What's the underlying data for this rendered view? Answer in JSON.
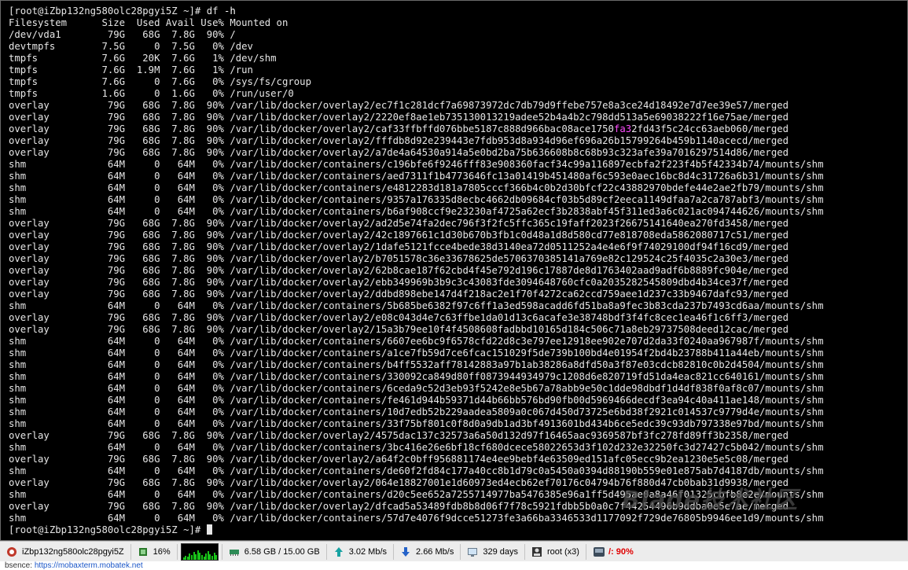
{
  "terminal": {
    "prompt": "[root@iZbp132ng580olc28pgyi5Z ~]# ",
    "command": "df",
    "command_arg": "-h",
    "header": "Filesystem      Size  Used Avail Use% Mounted on",
    "rows": [
      "/dev/vda1        79G   68G  7.8G  90% /",
      "devtmpfs        7.5G     0  7.5G   0% /dev",
      "tmpfs           7.6G   20K  7.6G   1% /dev/shm",
      "tmpfs           7.6G  1.9M  7.6G   1% /run",
      "tmpfs           7.6G     0  7.6G   0% /sys/fs/cgroup",
      "tmpfs           1.6G     0  1.6G   0% /run/user/0",
      "overlay          79G   68G  7.8G  90% /var/lib/docker/overlay2/ec7f1c281dcf7a69873972dc7db79d9ffebe757e8a3ce24d18492e7d7ee39e57/merged",
      "overlay          79G   68G  7.8G  90% /var/lib/docker/overlay2/2220ef8ae1eb735130013219adee52b4a4b2c798dd513a5e69038222f16e75ae/merged",
      "overlay          79G   68G  7.8G  90% /var/lib/docker/overlay2/caf33ffbffd076bbe5187c888d966bac08ace1750fa32fd43f5c24cc63aeb060/merged",
      "overlay          79G   68G  7.8G  90% /var/lib/docker/overlay2/fffdb8d92e239443e7fdb953d8a934d96ef696a26b15799264b459b1140acecd/merged",
      "overlay          79G   68G  7.8G  90% /var/lib/docker/overlay2/a7de4a64530a914a5e0bd2ba75b636608b8c68b93c323afe39a7016297514d86/merged",
      "shm              64M     0   64M   0% /var/lib/docker/containers/c196bfe6f9246fff83e908360facf34c99a116897ecbfa2f223f4b5f42334b74/mounts/shm",
      "shm              64M     0   64M   0% /var/lib/docker/containers/aed7311f1b4773646fc13a01419b451480af6c593e0aec16bc8d4c31726a6b31/mounts/shm",
      "shm              64M     0   64M   0% /var/lib/docker/containers/e4812283d181a7805cccf366b4c0b2d30bfcf22c43882970bdefe44e2ae2fb79/mounts/shm",
      "shm              64M     0   64M   0% /var/lib/docker/containers/9357a176335d8ecbc4662db09684cf03b5d89cf2eeca1149dfaa7a2ca787abf3/mounts/shm",
      "shm              64M     0   64M   0% /var/lib/docker/containers/b6af908ccf9e23230af4725a62ecf3b2838abf45f311ed3a6c021ac094744626/mounts/shm",
      "overlay          79G   68G  7.8G  90% /var/lib/docker/overlay2/ad2d5e74fa2dec796f3f2fc5ffc365c19faff2023f26675141640ea270fd3458/merged",
      "overlay          79G   68G  7.8G  90% /var/lib/docker/overlay2/42c1897661c1d30b670b3fb1c0d48a1d8d580cd77e818708eda5862080717c51/merged",
      "overlay          79G   68G  7.8G  90% /var/lib/docker/overlay2/1dafe5121fcce4bede38d3140ea72d0511252a4e4e6f9f74029100df94f16cd9/merged",
      "overlay          79G   68G  7.8G  90% /var/lib/docker/overlay2/b7051578c36e33678625de5706370385141a769e82c129524c25f4035c2a30e3/merged",
      "overlay          79G   68G  7.8G  90% /var/lib/docker/overlay2/62b8cae187f62cbd4f45e792d196c17887de8d1763402aad9adf6b8889fc904e/merged",
      "overlay          79G   68G  7.8G  90% /var/lib/docker/overlay2/ebb349969b3b9c3c43083fde3094648760cfc0a2035282545809dbd4b34ce37f/merged",
      "overlay          79G   68G  7.8G  90% /var/lib/docker/overlay2/ddbd898ebe147d4f218ac2e1f70f4272ca62ccd759aee1d237c33b9467dafc93/merged",
      "shm              64M     0   64M   0% /var/lib/docker/containers/5b685be6382f97c6ff1a3ed598acadd6fd51ba8a9fec3b83cda237b7493cd6aa/mounts/shm",
      "overlay          79G   68G  7.8G  90% /var/lib/docker/overlay2/e08c043d4e7c63ffbe1da01d13c6acafe3e38748bdf3f4fc8cec1ea46f1c6ff3/merged",
      "overlay          79G   68G  7.8G  90% /var/lib/docker/overlay2/15a3b79ee10f4f4508608fadbbd10165d184c506c71a8eb29737508deed12cac/merged",
      "shm              64M     0   64M   0% /var/lib/docker/containers/6607ee6bc9f6578cfd22d8c3e797ee12918ee902e707d2da33f0240aa967987f/mounts/shm",
      "shm              64M     0   64M   0% /var/lib/docker/containers/a1ce7fb59d7ce6fcac151029f5de739b100bd4e01954f2bd4b23788b411a44eb/mounts/shm",
      "shm              64M     0   64M   0% /var/lib/docker/containers/b4ff5532aff78142883a97b1ab38286a8dfd50a3f87e03cdcb82810c0b2d4504/mounts/shm",
      "shm              64M     0   64M   0% /var/lib/docker/containers/330092ca849d80ff0873944934979c1208d6e820719fd51da4eac821cc640161/mounts/shm",
      "shm              64M     0   64M   0% /var/lib/docker/containers/6ceda9c52d3eb93f5242e8e5b67a78abb9e50c1dde98dbdf1d4df838f0af8c07/mounts/shm",
      "shm              64M     0   64M   0% /var/lib/docker/containers/fe461d944b59371d44b66bb576bd90fb00d5969466decdf3ea94c40a411ae148/mounts/shm",
      "shm              64M     0   64M   0% /var/lib/docker/containers/10d7edb52b229aadea5809a0c067d450d73725e6bd38f2921c014537c9779d4e/mounts/shm",
      "shm              64M     0   64M   0% /var/lib/docker/containers/33f75bf801c0f8d0a9db1ad3bf4913601bd434b6ce5edc39c93db797338e97bd/mounts/shm",
      "overlay          79G   68G  7.8G  90% /var/lib/docker/overlay2/4575dac137c32573a6a50d132d97f16465aac9369587bf3fc278fd89ff3b2358/merged",
      "shm              64M     0   64M   0% /var/lib/docker/containers/3bc416e26e6bf18cf680dcece58022653d3f102d232e32250fc3d27427c5b042/mounts/shm",
      "overlay          79G   68G  7.8G  90% /var/lib/docker/overlay2/a64f2c0bff956881174e4ee9bebf4e63509ed151afc05ecc9b2ea1230e5e5c08/merged",
      "shm              64M     0   64M   0% /var/lib/docker/containers/de60f2fd84c177a40cc8b1d79c0a5450a0394d88190b559e01e875ab7d4187db/mounts/shm",
      "overlay          79G   68G  7.8G  90% /var/lib/docker/overlay2/064e18827001e1d60973ed4ecb62ef70176c04794b76f880d47cb0bab31d9938/merged",
      "shm              64M     0   64M   0% /var/lib/docker/containers/d20c5ee652a7255714977ba5476385e96a1ff5d495ae0a8a46f01325cbfb8e2e/mounts/shm",
      "overlay          79G   68G  7.8G  90% /var/lib/docker/overlay2/dfcad5a53489fdb8b8d06f7f78c5921fdbb5b0a0c7f44254496b9ddba0e5e7ae/merged",
      "shm              64M     0   64M   0% /var/lib/docker/containers/57d7e4076f9dcce51273fe3a66ba3346533d1177092f729de76805b9946ee1d9/mounts/shm"
    ],
    "highlight_row": 8,
    "highlight_text": "fa3",
    "final_prompt": "[root@iZbp132ng580olc28pgyi5Z ~]# "
  },
  "watermark": "Blade技术社区",
  "statusbar": {
    "host": "iZbp132ng580olc28pgyi5Z",
    "cpu": "16%",
    "memory": "6.58 GB / 15.00 GB",
    "upload": "3.02 Mb/s",
    "download": "2.66 Mb/s",
    "uptime": "329 days",
    "user": "root (x3)",
    "disk": "/: 90%",
    "disk_color": "#e00000"
  },
  "urlbar": {
    "prefix": "bsence: ",
    "link": "https://mobaxterm.mobatek.net"
  }
}
